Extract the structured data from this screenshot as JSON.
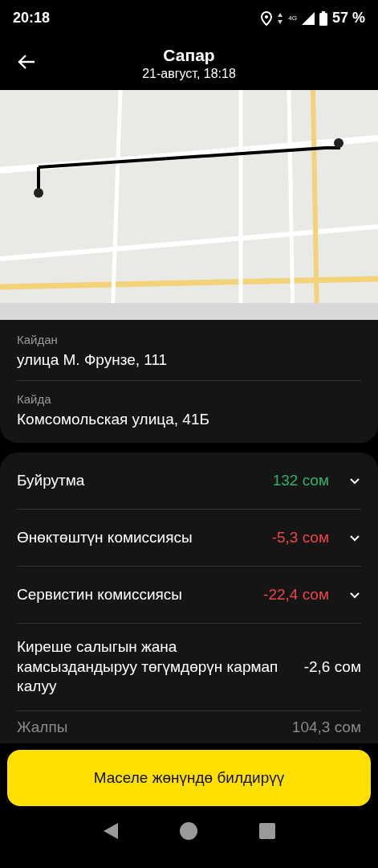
{
  "status_bar": {
    "time": "20:18",
    "network": "4G",
    "battery": "57 %"
  },
  "header": {
    "title": "Сапар",
    "subtitle": "21-август, 18:18"
  },
  "addresses": [
    {
      "label": "Кайдан",
      "value": "улица М. Фрунзе, 111"
    },
    {
      "label": "Кайда",
      "value": "Комсомольская улица, 41Б"
    }
  ],
  "details": [
    {
      "kind": "expandable",
      "label": "Буйрутма",
      "amount": "132 сом",
      "color": "#2db36b",
      "expanded": false
    },
    {
      "kind": "expandable",
      "label": "Өнөктөштүн комиссиясы",
      "amount": "-5,3 сом",
      "color": "#f0444b",
      "expanded": false
    },
    {
      "kind": "expandable",
      "label": "Сервистин комиссиясы",
      "amount": "-22,4 сом",
      "color": "#f0444b",
      "expanded": false
    },
    {
      "kind": "plain",
      "label": "Киреше салыгын жана камсыздандыруу төгүмдөрүн кармап калуу",
      "amount": "-2,6 сом",
      "color": "#ffffff"
    },
    {
      "kind": "total",
      "label": "Жалпы",
      "amount": "104,3 сом",
      "color": "#8a8a8a"
    }
  ],
  "action_button": "Маселе жөнүндө билдирүү"
}
